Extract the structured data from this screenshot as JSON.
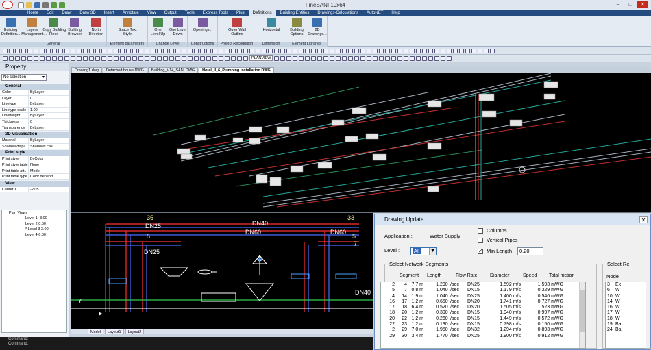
{
  "app": {
    "title": "FineSANI 19x64"
  },
  "menu": [
    "Home",
    "Edit",
    "Draw",
    "Draw 3D",
    "Insert",
    "Annotate",
    "View",
    "Output",
    "Tools",
    "Express Tools",
    "Plus",
    "Definitions",
    "Building Entities",
    "Drawings-Calculations",
    "AutoNET",
    "Help"
  ],
  "menu_active": "Definitions",
  "ribbon": {
    "groups": [
      {
        "label": "General",
        "buttons": [
          "Building\nDefinition...",
          "Layers\nManagement...",
          "Copy Building\nFloor",
          "Building\nBrowser",
          "North\nDirection"
        ]
      },
      {
        "label": "Element parameters",
        "buttons": [
          "Space Text\nStyle"
        ]
      },
      {
        "label": "Change Level",
        "buttons": [
          "One\nLevel Up",
          "One Level\nDown"
        ]
      },
      {
        "label": "Constructions",
        "buttons": [
          "Openings..."
        ]
      },
      {
        "label": "Project Recognition",
        "buttons": [
          "Outer Wall\nOutline"
        ]
      },
      {
        "label": "Dimension",
        "buttons": [
          "Horizontal"
        ]
      },
      {
        "label": "Element Libraries",
        "buttons": [
          "Building\nOptions",
          "2D\nDrawings..."
        ]
      }
    ]
  },
  "toolbar": {
    "view_select": "PLANVIEW"
  },
  "property_panel": {
    "title": "Property",
    "selection": "No selection",
    "sections": [
      {
        "name": "General",
        "rows": [
          [
            "Color",
            "ByLayer"
          ],
          [
            "Layer",
            "0"
          ],
          [
            "Linetype",
            "ByLayer"
          ],
          [
            "Linetype scale",
            "1.00"
          ],
          [
            "Lineweight",
            "ByLayer"
          ],
          [
            "Thickness",
            "0"
          ],
          [
            "Transparency",
            "ByLayer"
          ]
        ]
      },
      {
        "name": "3D Visualisation",
        "rows": [
          [
            "Material",
            "ByLayer"
          ],
          [
            "Shadow displ...",
            "Shadows cas..."
          ]
        ]
      },
      {
        "name": "Print style",
        "rows": [
          [
            "Print style",
            "ByColor"
          ],
          [
            "Print style table",
            "None"
          ],
          [
            "Print table att...",
            "Model"
          ],
          [
            "Print table type",
            "Color depend..."
          ]
        ]
      },
      {
        "name": "View",
        "rows": [
          [
            "Center X",
            "-2.05"
          ]
        ]
      }
    ]
  },
  "plan_views": {
    "root": "Plan Views",
    "items": [
      "Level 1 -3.00",
      "Level 2 0.00",
      "* Level 3 3.00",
      "Level 4 6.00"
    ]
  },
  "doc_tabs": [
    "Drawing1.dwg",
    "Detached house.DWG",
    "Building_V14_SANI.DWG",
    "Hotel_II_6_Plumbing installation.DWG"
  ],
  "doc_tab_active": "Hotel_II_6_Plumbing installation.DWG",
  "layout_tabs": [
    "Model",
    "Layout1",
    "Layout2"
  ],
  "command_lines": [
    "Command:",
    "Command:"
  ],
  "cad2d_labels": {
    "num_left": "35",
    "num_right": "33",
    "dn25_a": "DN25",
    "dn40_a": "DN40",
    "dn60_a": "DN60",
    "dn60_b": "DN60",
    "dn25_b": "DN25",
    "dn40_b": "DN40",
    "num_5a": "5",
    "num_5b": "5",
    "num_7": "7",
    "axis_y": "Y"
  },
  "dialog": {
    "title": "Drawing Update",
    "application_label": "Application :",
    "application_value": "Water Supply",
    "level_label": "Level :",
    "level_value": "All",
    "columns_label": "Columns",
    "vertical_pipes_label": "Vertical Pipes",
    "min_length_label": "Min Length",
    "min_length_value": "0.20",
    "columns_checked": false,
    "vertical_pipes_checked": false,
    "min_length_checked": true,
    "segments_group": "Select Network Segments",
    "nodes_group": "Select Re",
    "segment_headers": [
      "Segment",
      "Length",
      "Flow Rate",
      "Diameter",
      "Speed",
      "Total friction"
    ],
    "segments": [
      [
        "2",
        "4",
        "7.7 m",
        "1.290 l/sec",
        "DN25",
        "1.592 m/s",
        "1.593 mWG"
      ],
      [
        "5",
        "7",
        "0.8 m",
        "1.040 l/sec",
        "DN15",
        "1.179 m/s",
        "0.329 mWG"
      ],
      [
        "4",
        "14",
        "1.9 m",
        "1.040 l/sec",
        "DN25",
        "1.400 m/s",
        "0.546 mWG"
      ],
      [
        "16",
        "17",
        "1.2 m",
        "0.650 l/sec",
        "DN20",
        "1.741 m/s",
        "0.727 mWG"
      ],
      [
        "17",
        "18",
        "6.4 m",
        "0.520 l/sec",
        "DN20",
        "1.505 m/s",
        "1.523 mWG"
      ],
      [
        "18",
        "20",
        "1.2 m",
        "0.390 l/sec",
        "DN15",
        "1.940 m/s",
        "0.997 mWG"
      ],
      [
        "20",
        "22",
        "1.2 m",
        "0.260 l/sec",
        "DN15",
        "1.449 m/s",
        "0.572 mWG"
      ],
      [
        "22",
        "23",
        "1.2 m",
        "0.130 l/sec",
        "DN15",
        "0.798 m/s",
        "0.150 mWG"
      ],
      [
        "2",
        "29",
        "7.0 m",
        "1.950 l/sec",
        "DN32",
        "1.294 m/s",
        "0.893 mWG"
      ],
      [
        "29",
        "30",
        "3.4 m",
        "1.770 l/sec",
        "DN25",
        "1.900 m/s",
        "0.912 mWG"
      ]
    ],
    "node_header": "Node",
    "nodes": [
      [
        "3",
        "Ek"
      ],
      [
        "6",
        "W"
      ],
      [
        "10",
        "W"
      ],
      [
        "14",
        "W"
      ],
      [
        "16",
        "W"
      ],
      [
        "17",
        "W"
      ],
      [
        "18",
        "W"
      ],
      [
        "19",
        "Ba"
      ],
      [
        "24",
        "Ba"
      ]
    ]
  }
}
